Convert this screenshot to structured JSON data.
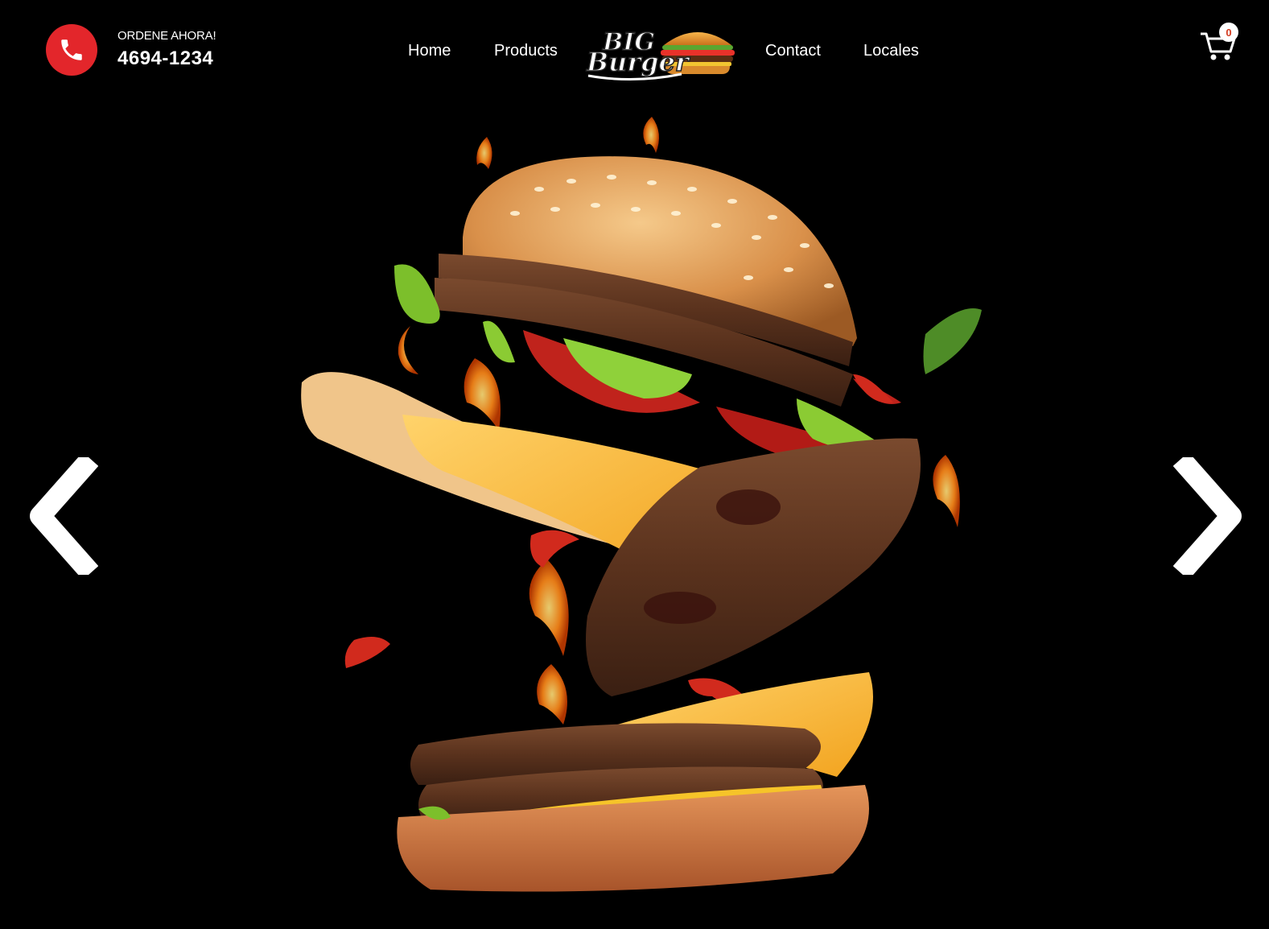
{
  "header": {
    "order_label": "ORDENE AHORA!",
    "phone_number": "4694-1234",
    "nav": {
      "home": "Home",
      "products": "Products",
      "contact": "Contact",
      "locales": "Locales"
    },
    "logo": {
      "line1": "BIG",
      "line2": "Burger"
    },
    "cart_count": "0"
  },
  "slider": {
    "prev_icon": "chevron-left-icon",
    "next_icon": "chevron-right-icon",
    "image": "exploding-burger-image"
  },
  "colors": {
    "background": "#000000",
    "accent_red": "#e3262b",
    "text": "#ffffff"
  }
}
